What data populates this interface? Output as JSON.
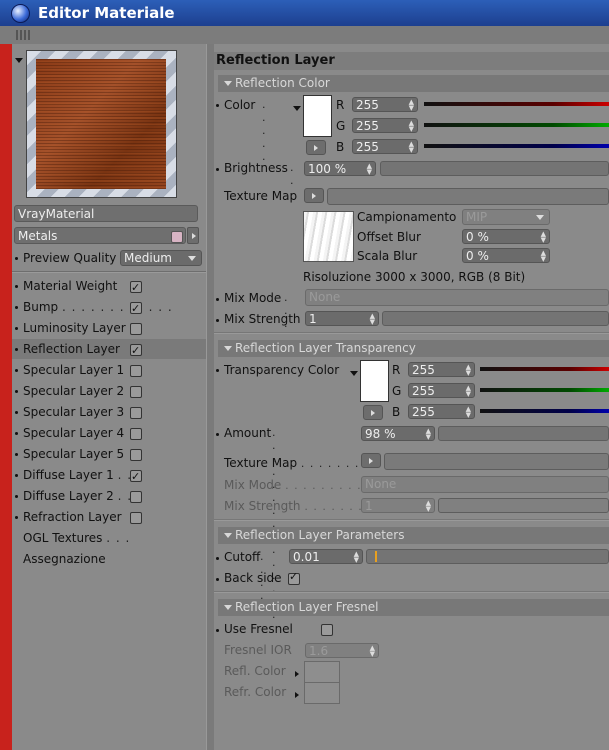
{
  "window": {
    "title": "Editor Materiale"
  },
  "left": {
    "material_name": "VrayMaterial",
    "material_group": "Metals",
    "preview_quality_label": "Preview Quality",
    "preview_quality_value": "Medium",
    "items": [
      {
        "label": "Material Weight",
        "checked": true
      },
      {
        "label": "Bump",
        "checked": true
      },
      {
        "label": "Luminosity Layer",
        "checked": false
      },
      {
        "label": "Reflection Layer",
        "checked": true
      },
      {
        "label": "Specular Layer 1",
        "checked": false
      },
      {
        "label": "Specular Layer 2",
        "checked": false
      },
      {
        "label": "Specular Layer 3",
        "checked": false
      },
      {
        "label": "Specular Layer 4",
        "checked": false
      },
      {
        "label": "Specular Layer 5",
        "checked": false
      },
      {
        "label": "Diffuse Layer 1",
        "checked": true
      },
      {
        "label": "Diffuse Layer 2",
        "checked": false
      },
      {
        "label": "Refraction Layer",
        "checked": false
      }
    ],
    "ogl_textures": "OGL Textures",
    "assegnazione": "Assegnazione"
  },
  "main": {
    "header": "Reflection Layer",
    "reflection_color": {
      "section": "Reflection Color",
      "color_label": "Color",
      "r_label": "R",
      "g_label": "G",
      "b_label": "B",
      "r": "255",
      "g": "255",
      "b": "255",
      "brightness_label": "Brightness",
      "brightness": "100 %",
      "texture_map_label": "Texture Map",
      "campionamento_label": "Campionamento",
      "campionamento": "MIP",
      "offset_blur_label": "Offset Blur",
      "offset_blur": "0 %",
      "scala_blur_label": "Scala Blur",
      "scala_blur": "0 %",
      "resolution": "Risoluzione 3000 x 3000, RGB (8 Bit)",
      "mix_mode_label": "Mix Mode",
      "mix_mode": "None",
      "mix_strength_label": "Mix Strength",
      "mix_strength": "1"
    },
    "transparency": {
      "section": "Reflection Layer Transparency",
      "color_label": "Transparency Color",
      "r_label": "R",
      "g_label": "G",
      "b_label": "B",
      "r": "255",
      "g": "255",
      "b": "255",
      "amount_label": "Amount",
      "amount": "98 %",
      "texture_map_label": "Texture Map",
      "mix_mode_label": "Mix Mode",
      "mix_mode": "None",
      "mix_strength_label": "Mix Strength",
      "mix_strength": "1"
    },
    "parameters": {
      "section": "Reflection Layer Parameters",
      "cutoff_label": "Cutoff",
      "cutoff": "0.01",
      "backside_label": "Back side"
    },
    "fresnel": {
      "section": "Reflection Layer Fresnel",
      "use_label": "Use Fresnel",
      "ior_label": "Fresnel IOR",
      "ior": "1.6",
      "refl_label": "Refl. Color",
      "refr_label": "Refr. Color"
    }
  },
  "colors": {
    "titlebar": "#2c5fb8",
    "left_strip": "#c8221c",
    "accent_marker": "#e8a020"
  }
}
